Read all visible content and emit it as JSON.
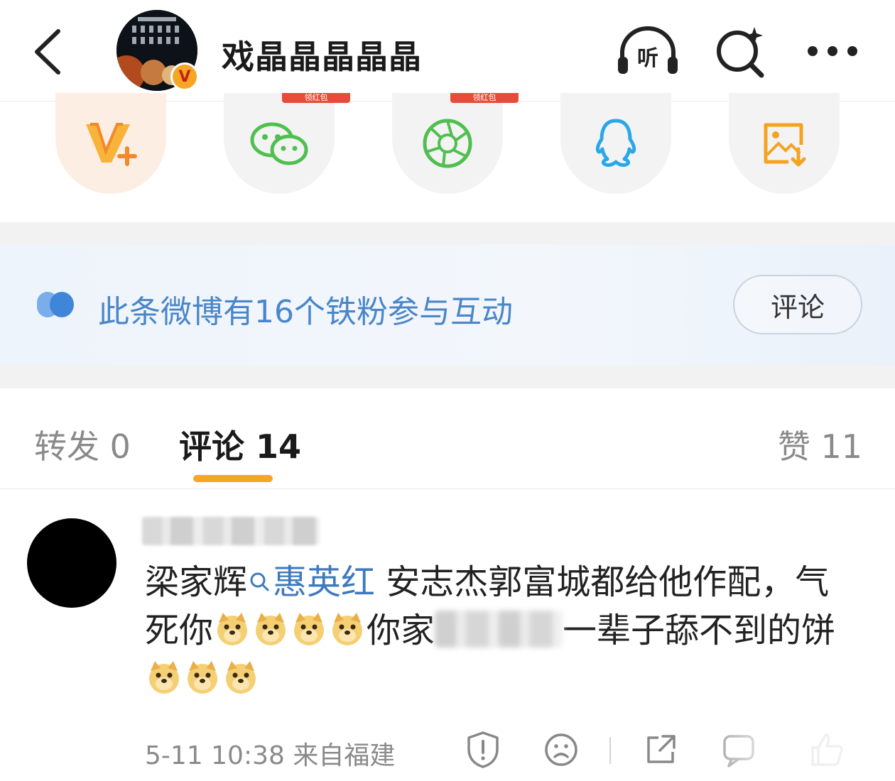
{
  "header": {
    "user_name": "戏晶晶晶晶晶",
    "verified_badge": "V",
    "icons": [
      "back-arrow-icon",
      "listen-icon",
      "search-spark-icon",
      "more-dots-icon"
    ],
    "listen_label": "听"
  },
  "share": {
    "items": [
      {
        "name": "vip-plus",
        "icon": "vip-plus-icon"
      },
      {
        "name": "wechat",
        "icon": "wechat-icon",
        "tag": "领红包"
      },
      {
        "name": "moments",
        "icon": "moments-icon",
        "tag": "领红包"
      },
      {
        "name": "qq",
        "icon": "qq-icon"
      },
      {
        "name": "save-image",
        "icon": "save-image-icon"
      }
    ]
  },
  "fans_banner": {
    "text": "此条微博有16个铁粉参与互动",
    "button": "评论"
  },
  "tabs": {
    "repost": "转发 0",
    "comment": "评论 14",
    "like": "赞 11"
  },
  "comment": {
    "text_part1": "梁家辉",
    "mention": "惠英红",
    "text_part2": " 安志杰郭富城都给他作配，气死你",
    "text_part3": "你家",
    "text_part4": "一辈子舔不到的饼",
    "emoji_name": "doge",
    "meta": "5-11 10:38 来自福建",
    "actions": [
      "report-icon",
      "sad-face-icon",
      "share-out-icon",
      "reply-icon",
      "like-icon"
    ]
  },
  "colors": {
    "accent": "#f5a623",
    "link": "#3e79bf",
    "banner_text": "#4a86c9"
  }
}
